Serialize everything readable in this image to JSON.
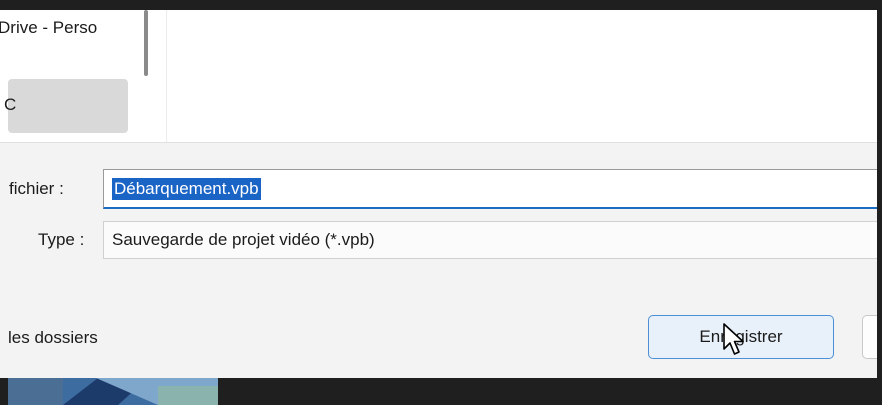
{
  "nav": {
    "onedrive_label": "Drive - Perso",
    "pc_label": "C"
  },
  "form": {
    "filename_label": "fichier :",
    "filename_value": "Débarquement.vpb",
    "type_label": "Type :",
    "type_value": "Sauvegarde de projet vidéo (*.vpb)"
  },
  "footer": {
    "hide_folders_label": "les dossiers",
    "save_label": "Enregistrer"
  },
  "colors": {
    "selection": "#1a64c5",
    "primary_button_border": "#4d8fd6",
    "panel_bg": "#f3f3f3"
  }
}
